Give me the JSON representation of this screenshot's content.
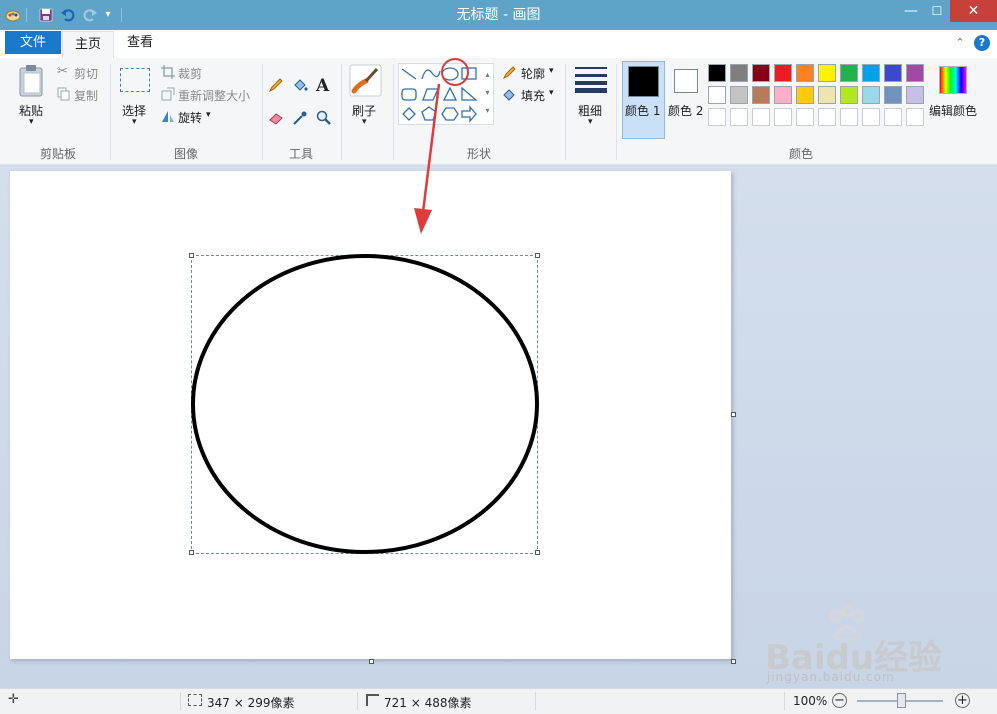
{
  "window": {
    "title": "无标题 - 画图",
    "minimize_glyph": "—",
    "maximize_glyph": "☐",
    "close_glyph": "✕"
  },
  "quick_access": {
    "icons": [
      "paint-app-icon",
      "save-icon",
      "undo-icon",
      "redo-icon",
      "customize-icon"
    ]
  },
  "tabs": {
    "file": "文件",
    "home": "主页",
    "view": "查看"
  },
  "ribbon": {
    "clipboard": {
      "label": "剪贴板",
      "paste": "粘贴",
      "cut": "剪切",
      "copy": "复制"
    },
    "image": {
      "label": "图像",
      "select": "选择",
      "crop": "裁剪",
      "resize": "重新调整大小",
      "rotate": "旋转"
    },
    "tools": {
      "label": "工具"
    },
    "brushes": {
      "label": "刷子"
    },
    "shapes": {
      "label": "形状",
      "outline": "轮廓",
      "fill": "填充"
    },
    "size": {
      "label": "粗细"
    },
    "colors": {
      "label": "颜色",
      "color1": "颜色 1",
      "color2": "颜色 2",
      "edit": "编辑颜色",
      "color1_value": "#000000",
      "color2_value": "#ffffff",
      "row1": [
        "#000000",
        "#7f7f7f",
        "#880015",
        "#ed1c24",
        "#ff7f27",
        "#fff200",
        "#22b14c",
        "#00a2e8",
        "#3f48cc",
        "#a349a4"
      ],
      "row2": [
        "#ffffff",
        "#c3c3c3",
        "#b97a57",
        "#ffaec9",
        "#ffc90e",
        "#efe4b0",
        "#b5e61d",
        "#99d9ea",
        "#7092be",
        "#c8bfe7"
      ]
    }
  },
  "status": {
    "selection_size": "347 × 299像素",
    "canvas_size": "721 × 488像素",
    "zoom": "100%",
    "zoom_minus": "−",
    "zoom_plus": "+"
  },
  "watermark": {
    "text": "Baidu经验",
    "url": "jingyan.baidu.com"
  }
}
